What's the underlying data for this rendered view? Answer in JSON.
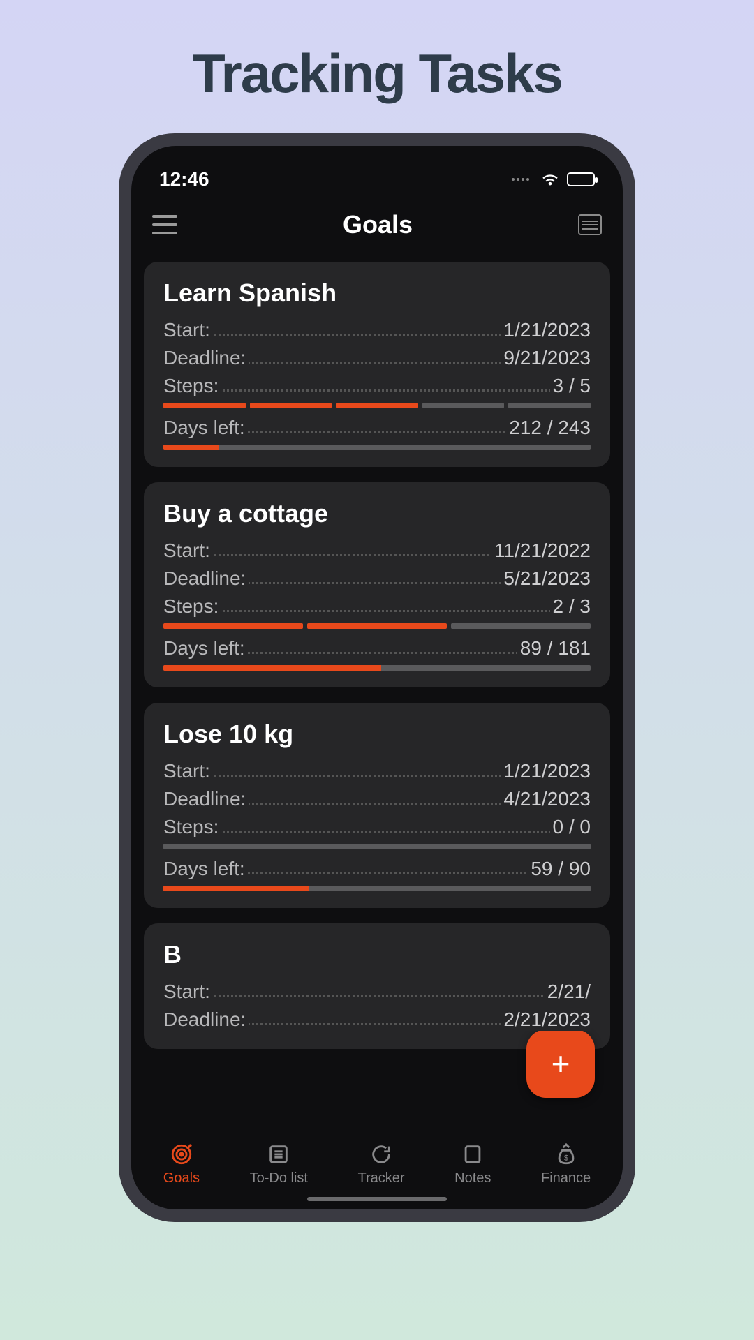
{
  "promo_title": "Tracking Tasks",
  "status": {
    "time": "12:46"
  },
  "header": {
    "title": "Goals"
  },
  "labels": {
    "start": "Start:",
    "deadline": "Deadline:",
    "steps": "Steps:",
    "days_left": "Days left:"
  },
  "goals": [
    {
      "title": "Learn Spanish",
      "start": "1/21/2023",
      "deadline": "9/21/2023",
      "steps_value": "3 / 5",
      "steps_done": 3,
      "steps_total": 5,
      "days_value": "212 / 243",
      "days_percent": 13
    },
    {
      "title": "Buy a cottage",
      "start": "11/21/2022",
      "deadline": "5/21/2023",
      "steps_value": "2 / 3",
      "steps_done": 2,
      "steps_total": 3,
      "days_value": "89 / 181",
      "days_percent": 51
    },
    {
      "title": "Lose 10 kg",
      "start": "1/21/2023",
      "deadline": "4/21/2023",
      "steps_value": "0 / 0",
      "steps_done": 0,
      "steps_total": 0,
      "days_value": "59 / 90",
      "days_percent": 34
    },
    {
      "title": "B",
      "start": "2/21/",
      "deadline": "2/21/2023",
      "steps_value": "",
      "steps_done": 0,
      "steps_total": 0,
      "days_value": "",
      "days_percent": 0
    }
  ],
  "nav": [
    {
      "label": "Goals",
      "active": true
    },
    {
      "label": "To-Do list",
      "active": false
    },
    {
      "label": "Tracker",
      "active": false
    },
    {
      "label": "Notes",
      "active": false
    },
    {
      "label": "Finance",
      "active": false
    }
  ],
  "fab_label": "+",
  "colors": {
    "accent": "#e8491b",
    "card_bg": "#262628",
    "screen_bg": "#0e0e10"
  }
}
